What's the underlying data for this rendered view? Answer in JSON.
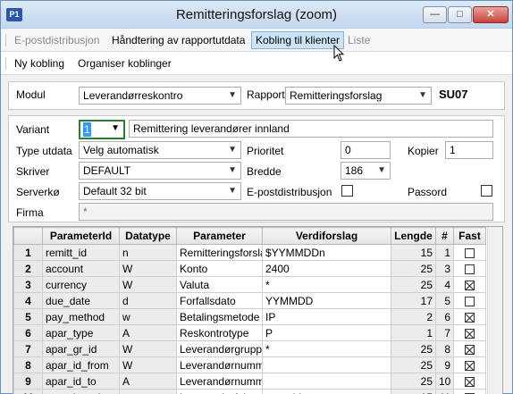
{
  "window": {
    "app_icon": "P1",
    "title": "Remitteringsforslag (zoom)",
    "minimize_glyph": "—",
    "maximize_glyph": "□",
    "close_glyph": "✕"
  },
  "menu": {
    "items": [
      {
        "label": "E-postdistribusjon",
        "state": "disabled"
      },
      {
        "label": "Håndtering av rapportutdata",
        "state": "normal"
      },
      {
        "label": "Kobling til klienter",
        "state": "active"
      },
      {
        "label": "Liste",
        "state": "disabled"
      }
    ]
  },
  "submenu": {
    "items": [
      {
        "label": "Ny kobling"
      },
      {
        "label": "Organiser koblinger"
      }
    ]
  },
  "form": {
    "modul_label": "Modul",
    "modul_value": "Leverandørreskontro",
    "rapport_label": "Rapport",
    "rapport_value": "Remitteringsforslag",
    "rapport_code": "SU07",
    "variant_label": "Variant",
    "variant_value": "1",
    "variant_desc": "Remittering leverandører innland",
    "type_utdata_label": "Type utdata",
    "type_utdata_value": "Velg automatisk",
    "prioritet_label": "Prioritet",
    "prioritet_value": "0",
    "kopier_label": "Kopier",
    "kopier_value": "1",
    "skriver_label": "Skriver",
    "skriver_value": "DEFAULT",
    "bredde_label": "Bredde",
    "bredde_value": "186",
    "serverko_label": "Serverkø",
    "serverko_value": "Default 32 bit",
    "epost_label": "E-postdistribusjon",
    "passord_label": "Passord",
    "firma_label": "Firma",
    "firma_value": "*"
  },
  "grid": {
    "columns": [
      "",
      "ParameterId",
      "Datatype",
      "Parameter",
      "Verdiforslag",
      "Lengde",
      "#",
      "Fast"
    ],
    "rows": [
      {
        "n": "1",
        "id": "remitt_id",
        "type": "n",
        "param": "Remitteringsforsla",
        "value": "$YYMMDDn",
        "len": "15",
        "idx": "1",
        "fast": false
      },
      {
        "n": "2",
        "id": "account",
        "type": "W",
        "param": "Konto",
        "value": "2400",
        "len": "25",
        "idx": "3",
        "fast": false
      },
      {
        "n": "3",
        "id": "currency",
        "type": "W",
        "param": "Valuta",
        "value": "*",
        "len": "25",
        "idx": "4",
        "fast": true
      },
      {
        "n": "4",
        "id": "due_date",
        "type": "d",
        "param": "Forfallsdato",
        "value": "YYMMDD",
        "len": "17",
        "idx": "5",
        "fast": false
      },
      {
        "n": "5",
        "id": "pay_method",
        "type": "w",
        "param": "Betalingsmetode",
        "value": "IP",
        "len": "2",
        "idx": "6",
        "fast": true
      },
      {
        "n": "6",
        "id": "apar_type",
        "type": "A",
        "param": "Reskontrotype",
        "value": "P",
        "len": "1",
        "idx": "7",
        "fast": true
      },
      {
        "n": "7",
        "id": "apar_gr_id",
        "type": "W",
        "param": "Leverandørgruppe",
        "value": "*",
        "len": "25",
        "idx": "8",
        "fast": true
      },
      {
        "n": "8",
        "id": "apar_id_from",
        "type": "W",
        "param": "Leverandørnumm",
        "value": "",
        "len": "25",
        "idx": "9",
        "fast": true
      },
      {
        "n": "9",
        "id": "apar_id_to",
        "type": "A",
        "param": "Leverandørnumm",
        "value": "",
        "len": "25",
        "idx": "10",
        "fast": true
      },
      {
        "n": "10",
        "id": "generic_col",
        "type": "a",
        "param": "Leverandørfelt",
        "value": "apar_id",
        "len": "15",
        "idx": "11",
        "fast": true
      }
    ]
  }
}
